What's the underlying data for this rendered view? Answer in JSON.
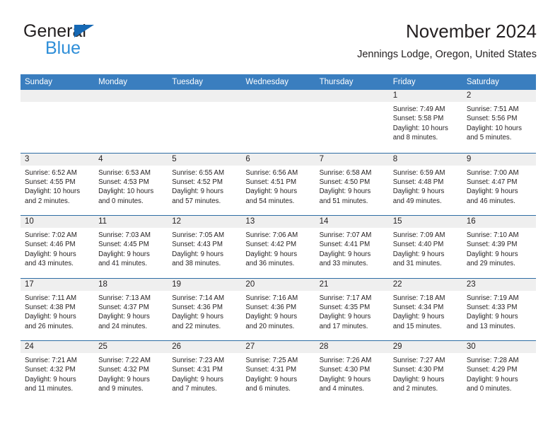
{
  "brand": {
    "line1": "General",
    "line2": "Blue",
    "triangle_color": "#1568b4",
    "blue_text_color": "#2e8ed8"
  },
  "header": {
    "title": "November 2024",
    "subtitle": "Jennings Lodge, Oregon, United States"
  },
  "theme": {
    "header_blue": "#3a7ebf",
    "row_divider_blue": "#2e6da4",
    "day_number_band": "#efefef"
  },
  "weekdays": [
    "Sunday",
    "Monday",
    "Tuesday",
    "Wednesday",
    "Thursday",
    "Friday",
    "Saturday"
  ],
  "weeks": [
    [
      {
        "day": "",
        "lines": []
      },
      {
        "day": "",
        "lines": []
      },
      {
        "day": "",
        "lines": []
      },
      {
        "day": "",
        "lines": []
      },
      {
        "day": "",
        "lines": []
      },
      {
        "day": "1",
        "lines": [
          "Sunrise: 7:49 AM",
          "Sunset: 5:58 PM",
          "Daylight: 10 hours",
          "and 8 minutes."
        ]
      },
      {
        "day": "2",
        "lines": [
          "Sunrise: 7:51 AM",
          "Sunset: 5:56 PM",
          "Daylight: 10 hours",
          "and 5 minutes."
        ]
      }
    ],
    [
      {
        "day": "3",
        "lines": [
          "Sunrise: 6:52 AM",
          "Sunset: 4:55 PM",
          "Daylight: 10 hours",
          "and 2 minutes."
        ]
      },
      {
        "day": "4",
        "lines": [
          "Sunrise: 6:53 AM",
          "Sunset: 4:53 PM",
          "Daylight: 10 hours",
          "and 0 minutes."
        ]
      },
      {
        "day": "5",
        "lines": [
          "Sunrise: 6:55 AM",
          "Sunset: 4:52 PM",
          "Daylight: 9 hours",
          "and 57 minutes."
        ]
      },
      {
        "day": "6",
        "lines": [
          "Sunrise: 6:56 AM",
          "Sunset: 4:51 PM",
          "Daylight: 9 hours",
          "and 54 minutes."
        ]
      },
      {
        "day": "7",
        "lines": [
          "Sunrise: 6:58 AM",
          "Sunset: 4:50 PM",
          "Daylight: 9 hours",
          "and 51 minutes."
        ]
      },
      {
        "day": "8",
        "lines": [
          "Sunrise: 6:59 AM",
          "Sunset: 4:48 PM",
          "Daylight: 9 hours",
          "and 49 minutes."
        ]
      },
      {
        "day": "9",
        "lines": [
          "Sunrise: 7:00 AM",
          "Sunset: 4:47 PM",
          "Daylight: 9 hours",
          "and 46 minutes."
        ]
      }
    ],
    [
      {
        "day": "10",
        "lines": [
          "Sunrise: 7:02 AM",
          "Sunset: 4:46 PM",
          "Daylight: 9 hours",
          "and 43 minutes."
        ]
      },
      {
        "day": "11",
        "lines": [
          "Sunrise: 7:03 AM",
          "Sunset: 4:45 PM",
          "Daylight: 9 hours",
          "and 41 minutes."
        ]
      },
      {
        "day": "12",
        "lines": [
          "Sunrise: 7:05 AM",
          "Sunset: 4:43 PM",
          "Daylight: 9 hours",
          "and 38 minutes."
        ]
      },
      {
        "day": "13",
        "lines": [
          "Sunrise: 7:06 AM",
          "Sunset: 4:42 PM",
          "Daylight: 9 hours",
          "and 36 minutes."
        ]
      },
      {
        "day": "14",
        "lines": [
          "Sunrise: 7:07 AM",
          "Sunset: 4:41 PM",
          "Daylight: 9 hours",
          "and 33 minutes."
        ]
      },
      {
        "day": "15",
        "lines": [
          "Sunrise: 7:09 AM",
          "Sunset: 4:40 PM",
          "Daylight: 9 hours",
          "and 31 minutes."
        ]
      },
      {
        "day": "16",
        "lines": [
          "Sunrise: 7:10 AM",
          "Sunset: 4:39 PM",
          "Daylight: 9 hours",
          "and 29 minutes."
        ]
      }
    ],
    [
      {
        "day": "17",
        "lines": [
          "Sunrise: 7:11 AM",
          "Sunset: 4:38 PM",
          "Daylight: 9 hours",
          "and 26 minutes."
        ]
      },
      {
        "day": "18",
        "lines": [
          "Sunrise: 7:13 AM",
          "Sunset: 4:37 PM",
          "Daylight: 9 hours",
          "and 24 minutes."
        ]
      },
      {
        "day": "19",
        "lines": [
          "Sunrise: 7:14 AM",
          "Sunset: 4:36 PM",
          "Daylight: 9 hours",
          "and 22 minutes."
        ]
      },
      {
        "day": "20",
        "lines": [
          "Sunrise: 7:16 AM",
          "Sunset: 4:36 PM",
          "Daylight: 9 hours",
          "and 20 minutes."
        ]
      },
      {
        "day": "21",
        "lines": [
          "Sunrise: 7:17 AM",
          "Sunset: 4:35 PM",
          "Daylight: 9 hours",
          "and 17 minutes."
        ]
      },
      {
        "day": "22",
        "lines": [
          "Sunrise: 7:18 AM",
          "Sunset: 4:34 PM",
          "Daylight: 9 hours",
          "and 15 minutes."
        ]
      },
      {
        "day": "23",
        "lines": [
          "Sunrise: 7:19 AM",
          "Sunset: 4:33 PM",
          "Daylight: 9 hours",
          "and 13 minutes."
        ]
      }
    ],
    [
      {
        "day": "24",
        "lines": [
          "Sunrise: 7:21 AM",
          "Sunset: 4:32 PM",
          "Daylight: 9 hours",
          "and 11 minutes."
        ]
      },
      {
        "day": "25",
        "lines": [
          "Sunrise: 7:22 AM",
          "Sunset: 4:32 PM",
          "Daylight: 9 hours",
          "and 9 minutes."
        ]
      },
      {
        "day": "26",
        "lines": [
          "Sunrise: 7:23 AM",
          "Sunset: 4:31 PM",
          "Daylight: 9 hours",
          "and 7 minutes."
        ]
      },
      {
        "day": "27",
        "lines": [
          "Sunrise: 7:25 AM",
          "Sunset: 4:31 PM",
          "Daylight: 9 hours",
          "and 6 minutes."
        ]
      },
      {
        "day": "28",
        "lines": [
          "Sunrise: 7:26 AM",
          "Sunset: 4:30 PM",
          "Daylight: 9 hours",
          "and 4 minutes."
        ]
      },
      {
        "day": "29",
        "lines": [
          "Sunrise: 7:27 AM",
          "Sunset: 4:30 PM",
          "Daylight: 9 hours",
          "and 2 minutes."
        ]
      },
      {
        "day": "30",
        "lines": [
          "Sunrise: 7:28 AM",
          "Sunset: 4:29 PM",
          "Daylight: 9 hours",
          "and 0 minutes."
        ]
      }
    ]
  ]
}
